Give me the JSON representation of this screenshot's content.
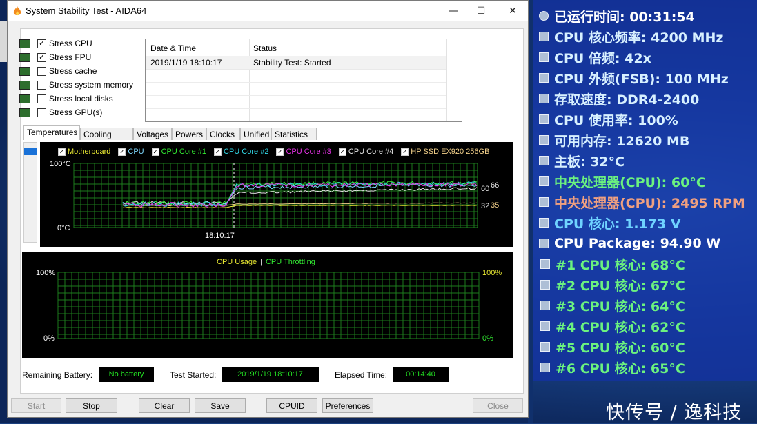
{
  "window": {
    "title": "System Stability Test - AIDA64",
    "minimize_glyph": "—",
    "maximize_glyph": "☐",
    "close_glyph": "✕"
  },
  "stress_options": [
    {
      "label": "Stress CPU",
      "checked": true,
      "icon": "cpu-chip-icon"
    },
    {
      "label": "Stress FPU",
      "checked": true,
      "icon": "fpu-chip-icon"
    },
    {
      "label": "Stress cache",
      "checked": false,
      "icon": "cache-chip-icon"
    },
    {
      "label": "Stress system memory",
      "checked": false,
      "icon": "memory-module-icon"
    },
    {
      "label": "Stress local disks",
      "checked": false,
      "icon": "disk-drive-icon"
    },
    {
      "label": "Stress GPU(s)",
      "checked": false,
      "icon": "monitor-icon"
    }
  ],
  "log": {
    "headers": [
      "Date & Time",
      "Status"
    ],
    "rows": [
      [
        "2019/1/19 18:10:17",
        "Stability Test: Started"
      ]
    ]
  },
  "tabs": [
    "Temperatures",
    "Cooling Fans",
    "Voltages",
    "Powers",
    "Clocks",
    "Unified",
    "Statistics"
  ],
  "temp_graph": {
    "legend": [
      {
        "label": "Motherboard",
        "color": "#e8e832"
      },
      {
        "label": "CPU",
        "color": "#7fd9ff"
      },
      {
        "label": "CPU Core #1",
        "color": "#32e832"
      },
      {
        "label": "CPU Core #2",
        "color": "#32d9e8"
      },
      {
        "label": "CPU Core #3",
        "color": "#e832e8"
      },
      {
        "label": "CPU Core #4",
        "color": "#e8e8e8"
      },
      {
        "label": "HP SSD EX920 256GB",
        "color": "#f2d08a"
      }
    ],
    "y_top": "100°C",
    "y_bottom": "0°C",
    "x_marker": "18:10:17",
    "end_values": {
      "v60": "60",
      "v66": "66",
      "v32": "32",
      "v35": "35"
    }
  },
  "usage_graph": {
    "label_usage": "CPU Usage",
    "label_sep": "|",
    "label_throttling": "CPU Throttling",
    "usage_color": "#e8e832",
    "throttle_color": "#32e832",
    "left_top": "100%",
    "left_bottom": "0%",
    "right_top": "100%",
    "right_bottom": "0%"
  },
  "status": {
    "battery_label": "Remaining Battery:",
    "battery_value": "No battery",
    "started_label": "Test Started:",
    "started_value": "2019/1/19 18:10:17",
    "elapsed_label": "Elapsed Time:",
    "elapsed_value": "00:14:40"
  },
  "buttons": {
    "start": "Start",
    "stop": "Stop",
    "clear": "Clear",
    "save": "Save",
    "cpuid": "CPUID",
    "preferences": "Preferences",
    "close": "Close"
  },
  "osd": [
    {
      "text": "已运行时间: 00:31:54",
      "color": "#ffffff",
      "icon": "clock-icon"
    },
    {
      "text": "CPU 核心频率: 4200 MHz",
      "color": "#d7f0ff",
      "icon": "cpu-icon"
    },
    {
      "text": "CPU 倍频: 42x",
      "color": "#d7f0ff",
      "icon": "cpu-icon"
    },
    {
      "text": "CPU 外频(FSB): 100 MHz",
      "color": "#d7f0ff",
      "icon": "cpu-icon"
    },
    {
      "text": "存取速度: DDR4-2400",
      "color": "#d7f0ff",
      "icon": "memory-icon"
    },
    {
      "text": "CPU 使用率: 100%",
      "color": "#d7f0ff",
      "icon": "hourglass-icon"
    },
    {
      "text": "可用内存: 12620 MB",
      "color": "#d7f0ff",
      "icon": "memory-icon"
    },
    {
      "text": "主板: 32°C",
      "color": "#d7f0ff",
      "icon": "motherboard-icon"
    },
    {
      "text": "中央处理器(CPU): 60°C",
      "color": "#6bf27f",
      "icon": "cpu-icon"
    },
    {
      "text": "中央处理器(CPU): 2495 RPM",
      "color": "#f0a080",
      "icon": "cpu-icon"
    },
    {
      "text": "CPU 核心: 1.173 V",
      "color": "#6fd3ff",
      "icon": "cpu-icon"
    },
    {
      "text": "CPU Package: 94.90 W",
      "color": "#ffffff",
      "icon": "cpu-icon"
    },
    {
      "text": "#1 CPU 核心: 68°C",
      "color": "#6bf27f",
      "icon": "cpu-icon"
    },
    {
      "text": "#2 CPU 核心: 67°C",
      "color": "#6bf27f",
      "icon": "cpu-icon"
    },
    {
      "text": "#3 CPU 核心: 64°C",
      "color": "#6bf27f",
      "icon": "cpu-icon"
    },
    {
      "text": "#4 CPU 核心: 62°C",
      "color": "#6bf27f",
      "icon": "cpu-icon"
    },
    {
      "text": "#5 CPU 核心: 60°C",
      "color": "#6bf27f",
      "icon": "cpu-icon"
    },
    {
      "text": "#6 CPU 核心: 65°C",
      "color": "#6bf27f",
      "icon": "cpu-icon"
    }
  ],
  "watermark": "快传号 / 逸科技"
}
